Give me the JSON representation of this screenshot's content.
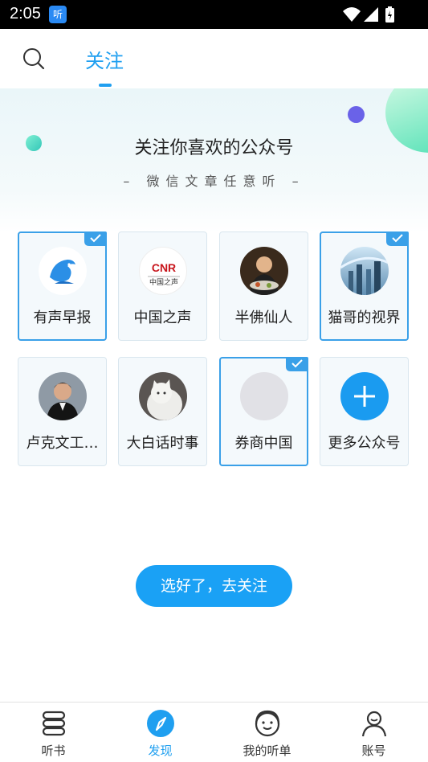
{
  "status_bar": {
    "time": "2:05",
    "app_icon_label": "听"
  },
  "header": {
    "search_icon": "search-icon",
    "tab_label": "关注"
  },
  "banner": {
    "title": "关注你喜欢的公众号",
    "subtitle": "– 微信文章任意听 –"
  },
  "accounts": [
    {
      "name": "有声早报",
      "selected": true,
      "avatar": "dolphin-logo"
    },
    {
      "name": "中国之声",
      "selected": false,
      "avatar": "cnr-logo",
      "logo_text": "CNR",
      "logo_sub": "中国之声"
    },
    {
      "name": "半佛仙人",
      "selected": false,
      "avatar": "person-photo"
    },
    {
      "name": "猫哥的视界",
      "selected": true,
      "avatar": "cityscape-photo"
    },
    {
      "name": "卢克文工…",
      "selected": false,
      "avatar": "man-photo"
    },
    {
      "name": "大白话时事",
      "selected": false,
      "avatar": "cat-photo"
    },
    {
      "name": "券商中国",
      "selected": true,
      "avatar": "placeholder"
    },
    {
      "name": "更多公众号",
      "selected": false,
      "avatar": "plus-icon"
    }
  ],
  "confirm_button": {
    "label": "选好了，去关注"
  },
  "bottom_nav": [
    {
      "label": "听书",
      "icon": "book-stack-icon",
      "active": false
    },
    {
      "label": "发现",
      "icon": "compass-icon",
      "active": true
    },
    {
      "label": "我的听单",
      "icon": "headphones-face-icon",
      "active": false
    },
    {
      "label": "账号",
      "icon": "user-icon",
      "active": false
    }
  ],
  "colors": {
    "accent": "#1f9ff0",
    "button": "#1aa1f5",
    "selected_border": "#3aa0e8"
  }
}
